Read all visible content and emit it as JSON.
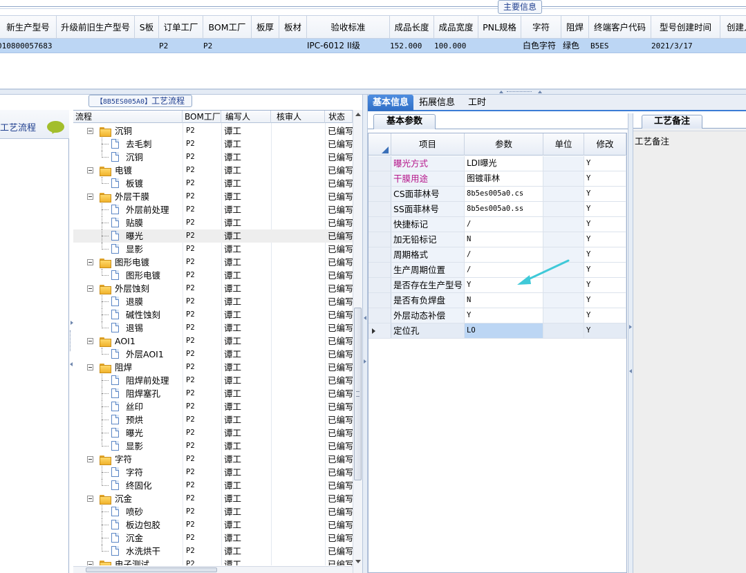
{
  "top": {
    "section_label": "主要信息",
    "columns": [
      "新生产型号",
      "升级前旧生产型号",
      "S板",
      "订单工厂",
      "BOM工厂",
      "板厚",
      "板材",
      "验收标准",
      "成品长度",
      "成品宽度",
      "PNL规格",
      "字符",
      "阻焊",
      "终端客户代码",
      "型号创建时间",
      "创建人"
    ],
    "row": {
      "new_model": "010800057683",
      "old_model": "",
      "s_board": "",
      "order_factory": "P2",
      "bom_factory": "P2",
      "thickness": "",
      "material": "",
      "acceptance": "IPC-6012 II级",
      "length": "152.000",
      "width": "100.000",
      "pnl": "",
      "character": "白色字符",
      "solder_mask": "绿色",
      "customer_code": "B5ES",
      "created": "2021/3/17",
      "creator": ""
    }
  },
  "left_nav": {
    "title": "工艺流程"
  },
  "flow": {
    "caption_code": "【8B5ES005A0】",
    "caption_text": "工艺流程",
    "headers": {
      "flow": "流程",
      "bom": "BOM工厂",
      "writer": "编写人",
      "reviewer": "核审人",
      "status": "状态"
    },
    "rows": [
      {
        "name": "沉铜",
        "group": true,
        "bom": "P2",
        "writer": "谭工",
        "status": "已编写"
      },
      {
        "name": "去毛刺",
        "group": false,
        "bom": "P2",
        "writer": "谭工",
        "status": "已编写"
      },
      {
        "name": "沉铜",
        "group": false,
        "bom": "P2",
        "writer": "谭工",
        "status": "已编写"
      },
      {
        "name": "电镀",
        "group": true,
        "bom": "P2",
        "writer": "谭工",
        "status": "已编写"
      },
      {
        "name": "板镀",
        "group": false,
        "bom": "P2",
        "writer": "谭工",
        "status": "已编写"
      },
      {
        "name": "外层干膜",
        "group": true,
        "bom": "P2",
        "writer": "谭工",
        "status": "已编写"
      },
      {
        "name": "外层前处理",
        "group": false,
        "bom": "P2",
        "writer": "谭工",
        "status": "已编写"
      },
      {
        "name": "贴膜",
        "group": false,
        "bom": "P2",
        "writer": "谭工",
        "status": "已编写"
      },
      {
        "name": "曝光",
        "group": false,
        "bom": "P2",
        "writer": "谭工",
        "status": "已编写",
        "selected": true
      },
      {
        "name": "显影",
        "group": false,
        "bom": "P2",
        "writer": "谭工",
        "status": "已编写"
      },
      {
        "name": "图形电镀",
        "group": true,
        "bom": "P2",
        "writer": "谭工",
        "status": "已编写"
      },
      {
        "name": "图形电镀",
        "group": false,
        "bom": "P2",
        "writer": "谭工",
        "status": "已编写"
      },
      {
        "name": "外层蚀刻",
        "group": true,
        "bom": "P2",
        "writer": "谭工",
        "status": "已编写"
      },
      {
        "name": "退膜",
        "group": false,
        "bom": "P2",
        "writer": "谭工",
        "status": "已编写"
      },
      {
        "name": "碱性蚀刻",
        "group": false,
        "bom": "P2",
        "writer": "谭工",
        "status": "已编写"
      },
      {
        "name": "退锡",
        "group": false,
        "bom": "P2",
        "writer": "谭工",
        "status": "已编写"
      },
      {
        "name": "AOI1",
        "group": true,
        "bom": "P2",
        "writer": "谭工",
        "status": "已编写"
      },
      {
        "name": "外层AOI1",
        "group": false,
        "bom": "P2",
        "writer": "谭工",
        "status": "已编写"
      },
      {
        "name": "阻焊",
        "group": true,
        "bom": "P2",
        "writer": "谭工",
        "status": "已编写"
      },
      {
        "name": "阻焊前处理",
        "group": false,
        "bom": "P2",
        "writer": "谭工",
        "status": "已编写"
      },
      {
        "name": "阻焊塞孔",
        "group": false,
        "bom": "P2",
        "writer": "谭工",
        "status": "已编写"
      },
      {
        "name": "丝印",
        "group": false,
        "bom": "P2",
        "writer": "谭工",
        "status": "已编写"
      },
      {
        "name": "预烘",
        "group": false,
        "bom": "P2",
        "writer": "谭工",
        "status": "已编写"
      },
      {
        "name": "曝光",
        "group": false,
        "bom": "P2",
        "writer": "谭工",
        "status": "已编写"
      },
      {
        "name": "显影",
        "group": false,
        "bom": "P2",
        "writer": "谭工",
        "status": "已编写"
      },
      {
        "name": "字符",
        "group": true,
        "bom": "P2",
        "writer": "谭工",
        "status": "已编写"
      },
      {
        "name": "字符",
        "group": false,
        "bom": "P2",
        "writer": "谭工",
        "status": "已编写"
      },
      {
        "name": "终固化",
        "group": false,
        "bom": "P2",
        "writer": "谭工",
        "status": "已编写"
      },
      {
        "name": "沉金",
        "group": true,
        "bom": "P2",
        "writer": "谭工",
        "status": "已编写"
      },
      {
        "name": "喷砂",
        "group": false,
        "bom": "P2",
        "writer": "谭工",
        "status": "已编写"
      },
      {
        "name": "板边包胶",
        "group": false,
        "bom": "P2",
        "writer": "谭工",
        "status": "已编写"
      },
      {
        "name": "沉金",
        "group": false,
        "bom": "P2",
        "writer": "谭工",
        "status": "已编写"
      },
      {
        "name": "水洗烘干",
        "group": false,
        "bom": "P2",
        "writer": "谭工",
        "status": "已编写"
      },
      {
        "name": "电子测试",
        "group": true,
        "bom": "P2",
        "writer": "谭工",
        "status": "已编写"
      }
    ]
  },
  "right": {
    "tabs": [
      "基本信息",
      "拓展信息",
      "工时"
    ],
    "sub_tab": "基本参数",
    "grid_headers": {
      "item": "项目",
      "param": "参数",
      "unit": "单位",
      "modify": "修改"
    },
    "params": [
      {
        "item": "曝光方式",
        "param": "LDI曝光",
        "unit": "",
        "modify": "Y",
        "highlight": true
      },
      {
        "item": "干膜用途",
        "param": "图镀菲林",
        "unit": "",
        "modify": "Y",
        "highlight": true
      },
      {
        "item": "CS面菲林号",
        "param": "8b5es005a0.cs",
        "unit": "",
        "modify": "Y",
        "mono": true
      },
      {
        "item": "SS面菲林号",
        "param": "8b5es005a0.ss",
        "unit": "",
        "modify": "Y",
        "mono": true
      },
      {
        "item": "快捷标记",
        "param": "/",
        "unit": "",
        "modify": "Y",
        "mono": true
      },
      {
        "item": "加无铅标记",
        "param": "N",
        "unit": "",
        "modify": "Y",
        "mono": true
      },
      {
        "item": "周期格式",
        "param": "/",
        "unit": "",
        "modify": "Y",
        "mono": true
      },
      {
        "item": "生产周期位置",
        "param": "/",
        "unit": "",
        "modify": "Y",
        "mono": true
      },
      {
        "item": "是否存在生产型号",
        "param": "Y",
        "unit": "",
        "modify": "Y",
        "mono": true
      },
      {
        "item": "是否有负焊盘",
        "param": "N",
        "unit": "",
        "modify": "Y",
        "mono": true
      },
      {
        "item": "外层动态补偿",
        "param": "Y",
        "unit": "",
        "modify": "Y",
        "mono": true
      },
      {
        "item": "定位孔",
        "param": "LO",
        "unit": "",
        "modify": "Y",
        "mono": true,
        "selected": true
      }
    ],
    "remarks_tab": "工艺备注",
    "remarks_label": "工艺备注"
  },
  "colors": {
    "accent": "#3a7bd5",
    "selection": "#bcd6f4",
    "magenta_label": "#b5158a",
    "arrow": "#3fc9d8"
  }
}
